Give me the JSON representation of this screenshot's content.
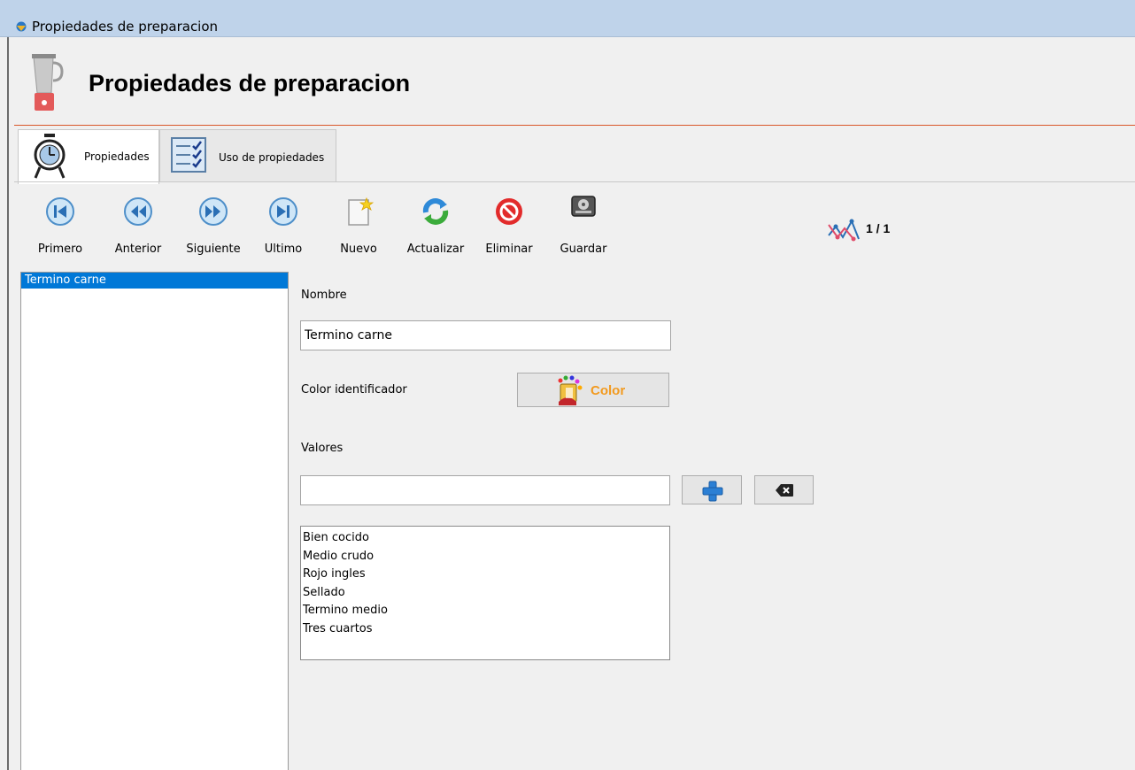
{
  "window": {
    "title": "Propiedades de preparacion"
  },
  "header": {
    "title": "Propiedades de preparacion",
    "icon": "blender-icon"
  },
  "tabs": [
    {
      "label": "Propiedades",
      "icon": "timer-icon",
      "active": true
    },
    {
      "label": "Uso de propiedades",
      "icon": "checklist-icon",
      "active": false
    }
  ],
  "toolbar": {
    "primero": "Primero",
    "anterior": "Anterior",
    "siguiente": "Siguiente",
    "ultimo": "Ultimo",
    "nuevo": "Nuevo",
    "actualizar": "Actualizar",
    "eliminar": "Eliminar",
    "guardar": "Guardar"
  },
  "counter": {
    "text": "1 / 1"
  },
  "records": [
    {
      "label": "Termino carne",
      "selected": true
    }
  ],
  "form": {
    "nombre_label": "Nombre",
    "nombre_value": "Termino carne",
    "color_label": "Color identificador",
    "color_button": "Color",
    "valores_label": "Valores",
    "valores_input": "",
    "values": [
      "Bien cocido",
      "Medio crudo",
      "Rojo ingles",
      "Sellado",
      "Termino medio",
      "Tres cuartos"
    ]
  },
  "colors": {
    "titlebar": "#bfd3ea",
    "selection": "#0078d7",
    "accent_line": "#d9572a",
    "color_button_text": "#f29a1f"
  }
}
